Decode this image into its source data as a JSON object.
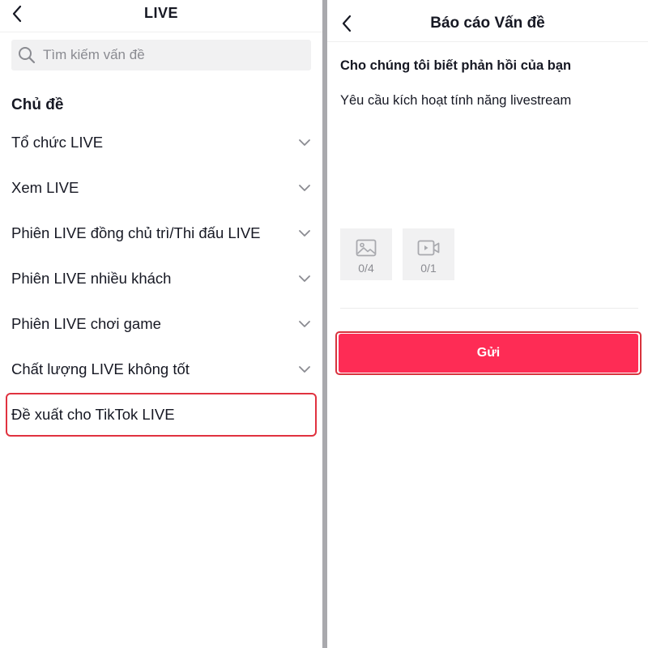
{
  "left": {
    "header": {
      "title": "LIVE"
    },
    "search": {
      "placeholder": "Tìm kiếm vấn đề",
      "value": ""
    },
    "section_title": "Chủ đề",
    "topics": [
      {
        "label": "Tổ chức LIVE",
        "expandable": true
      },
      {
        "label": "Xem LIVE",
        "expandable": true
      },
      {
        "label": "Phiên LIVE đồng chủ trì/Thi đấu LIVE",
        "expandable": true
      },
      {
        "label": "Phiên LIVE nhiều khách",
        "expandable": true
      },
      {
        "label": "Phiên LIVE chơi game",
        "expandable": true
      },
      {
        "label": "Chất lượng LIVE không tốt",
        "expandable": true
      },
      {
        "label": "Đề xuất cho TikTok LIVE",
        "expandable": false,
        "highlighted": true
      }
    ]
  },
  "right": {
    "header": {
      "title": "Báo cáo Vấn đề"
    },
    "feedback_label": "Cho chúng tôi biết phản hồi của bạn",
    "feedback_text": "Yêu cầu kích hoạt tính năng livestream",
    "uploads": [
      {
        "icon": "image-icon",
        "count": "0/4"
      },
      {
        "icon": "video-icon",
        "count": "0/1"
      }
    ],
    "submit_label": "Gửi"
  },
  "colors": {
    "accent": "#fe2c55",
    "highlight_border": "#e0323f",
    "divider": "#a9a9ad",
    "muted_text": "#8a8b91",
    "tile_bg": "#f1f1f2"
  }
}
